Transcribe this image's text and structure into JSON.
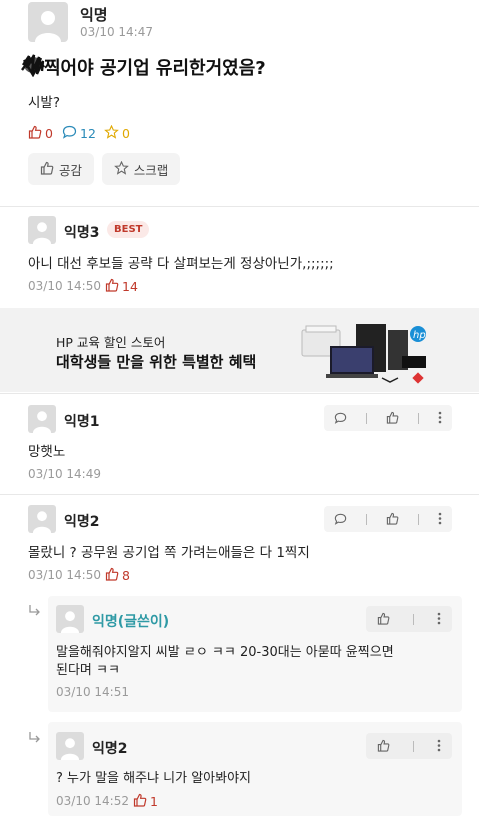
{
  "post": {
    "author": "익명",
    "time": "03/10 14:47",
    "title": "찍어야 공기업 유리한거였음?",
    "body": "시발?",
    "likes": "0",
    "comments": "12",
    "scraps": "0",
    "like_button": "공감",
    "scrap_button": "스크랩"
  },
  "best_comment": {
    "author": "익명3",
    "badge": "BEST",
    "text": "아니 대선 후보들 공략 다 살펴보는게 정상아닌가,;;;;;;",
    "time": "03/10 14:50",
    "likes": "14"
  },
  "ad": {
    "line1": "HP 교육 할인 스토어",
    "line2": "대학생들 만을 위한 특별한 혜택"
  },
  "comments": [
    {
      "author": "익명1",
      "text": "망햇노",
      "time": "03/10 14:49"
    },
    {
      "author": "익명2",
      "text": "몰랐니 ? 공무원 공기업 쪽 가려는애들은 다 1찍지",
      "time": "03/10 14:50",
      "likes": "8"
    }
  ],
  "replies": [
    {
      "author": "익명(글쓴이)",
      "text_line1": "말을해줘야지알지 씨발 ㄹㅇ ㅋㅋ 20-30대는 아묻따 윤찍으면",
      "text_line2": "된다며 ㅋㅋ",
      "time": "03/10 14:51"
    },
    {
      "author": "익명2",
      "text": "? 누가 말을 해주냐 니가 알아봐야지",
      "time": "03/10 14:52",
      "likes": "1"
    }
  ],
  "colors": {
    "like": "#c0392b",
    "comment": "#2a8ab8",
    "scrap": "#e0a800",
    "writer": "#2f9aa5"
  }
}
